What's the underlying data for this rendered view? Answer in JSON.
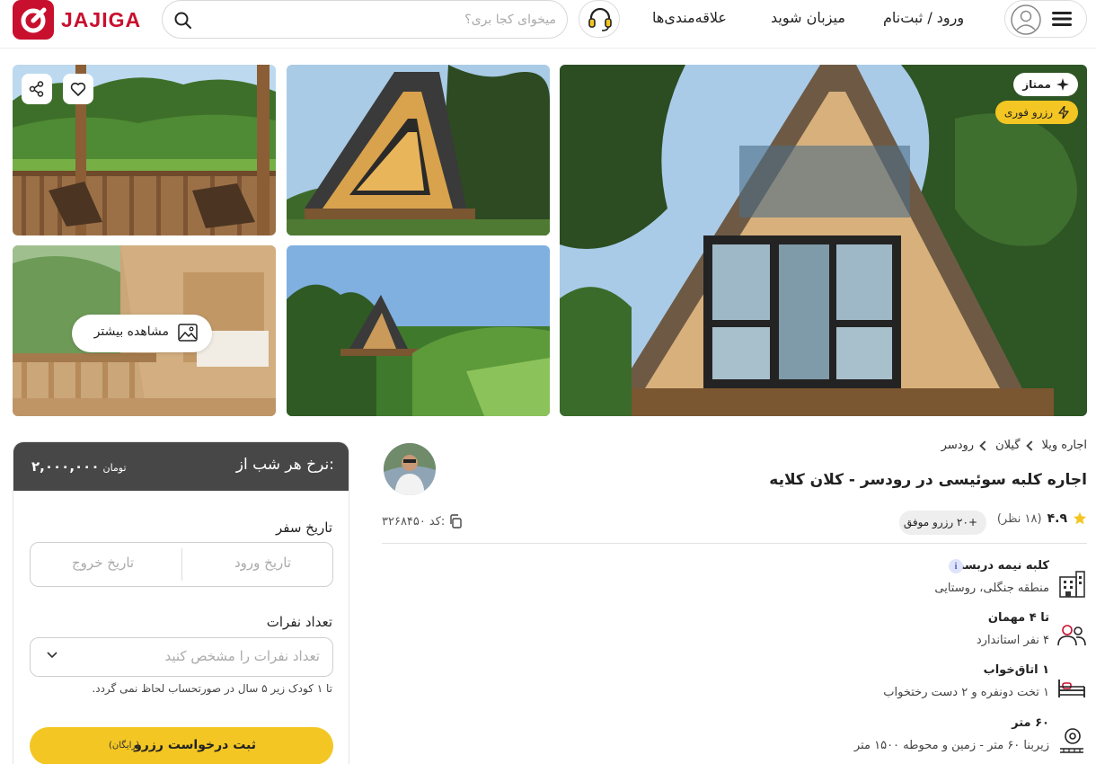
{
  "header": {
    "logo_text": "JAJIGA",
    "search_placeholder": "میخوای کجا بری؟",
    "nav": {
      "login": "ورود / ثبت‌نام",
      "host": "میزبان شوید",
      "favorites": "علاقه‌مندی‌ها"
    },
    "icons": {
      "search": "search-icon",
      "support": "headset-icon",
      "account": "user-icon",
      "menu": "hamburger-icon"
    }
  },
  "gallery": {
    "badges": {
      "premium": "ممتاز",
      "instant": "رزرو فوری"
    },
    "more_photos_label": "مشاهده بیشتر"
  },
  "booking": {
    "rate_label": "نرخ هر شب از:",
    "price": "۲,۰۰۰,۰۰۰",
    "currency": "تومان",
    "travel_date_label": "تاریخ سفر",
    "checkin_placeholder": "تاریخ ورود",
    "checkout_placeholder": "تاریخ خروج",
    "guests_label": "تعداد نفرات",
    "guests_placeholder": "تعداد نفرات را مشخص کنید",
    "child_note": "تا ۱ کودک زیر ۵ سال در صورتحساب لحاظ نمی گردد.",
    "submit_label": "ثبت درخواست رزرو",
    "submit_sub": "(رایگان)"
  },
  "listing": {
    "breadcrumb": [
      "اجاره ویلا",
      "گیلان",
      "رودسر"
    ],
    "title": "اجاره کلبه سوئیسی در رودسر - کلان کلایه",
    "rating": "۴.۹",
    "reviews": "(۱۸ نظر)",
    "successful_bookings": "+۲۰ رزرو موفق",
    "code_label": "کد:",
    "code_value": "۳۲۶۸۴۵۰",
    "features": [
      {
        "icon": "building-icon",
        "title": "کلبه نیمه دربست",
        "subtitle": "منطقه جنگلی، روستایی"
      },
      {
        "icon": "users-icon",
        "title": "تا ۴ مهمان",
        "subtitle": "۴ نفر استاندارد"
      },
      {
        "icon": "bed-icon",
        "title": "۱ اتاق‌خواب",
        "subtitle": "۱ تخت دونفره و ۲ دست رختخواب"
      },
      {
        "icon": "area-icon",
        "title": "۶۰ متر",
        "subtitle": "زیربنا ۶۰ متر - زمین و محوطه ۱۵۰۰ متر"
      }
    ]
  },
  "colors": {
    "brand_red": "#c8102e",
    "accent_yellow": "#f3c623",
    "card_header": "#474747"
  }
}
